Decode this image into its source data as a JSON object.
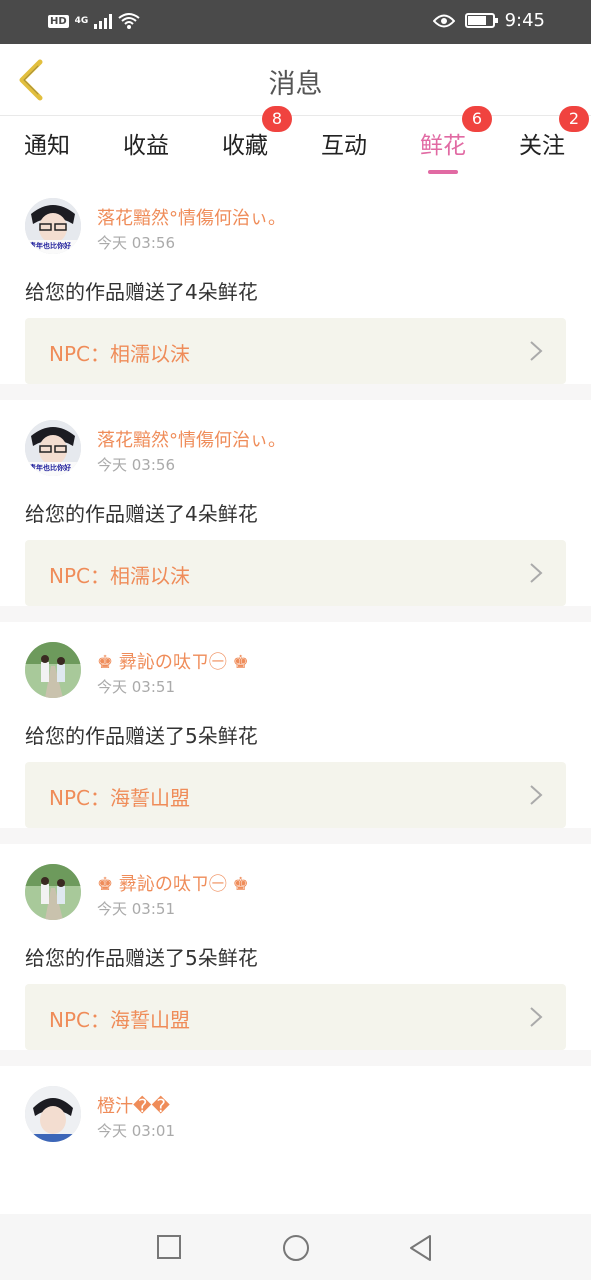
{
  "status_bar": {
    "hd": "HD",
    "network": "4G",
    "time": "9:45",
    "icons": [
      "hd-icon",
      "signal-icon",
      "wifi-icon",
      "eye-icon",
      "battery-icon"
    ]
  },
  "nav": {
    "title": "消息",
    "back_icon": "chevron-left-icon"
  },
  "tabs": [
    {
      "label": "通知"
    },
    {
      "label": "收益"
    },
    {
      "label": "收藏",
      "badge": "8"
    },
    {
      "label": "互动"
    },
    {
      "label": "鲜花",
      "badge": "6",
      "active": true
    },
    {
      "label": "关注",
      "badge": "2"
    }
  ],
  "colors": {
    "accent": "#e16aa3",
    "username": "#ef8c59",
    "badge": "#f0433f",
    "npc_bg": "#f4f4ec"
  },
  "messages": [
    {
      "username": "落花黯然°情傷何治ぃ。",
      "time": "今天 03:56",
      "text": "给您的作品赠送了4朵鲜花",
      "npc": "NPC：相濡以沫",
      "avatar_caption": "青年也比你好"
    },
    {
      "username": "落花黯然°情傷何治ぃ。",
      "time": "今天 03:56",
      "text": "给您的作品赠送了4朵鲜花",
      "npc": "NPC：相濡以沫",
      "avatar_caption": "青年也比你好"
    },
    {
      "username": "♚ 彛訫の呔ㄗ㊀ ♚",
      "time": "今天 03:51",
      "text": "给您的作品赠送了5朵鲜花",
      "npc": "NPC：海誓山盟"
    },
    {
      "username": "♚ 彛訫の呔ㄗ㊀ ♚",
      "time": "今天 03:51",
      "text": "给您的作品赠送了5朵鲜花",
      "npc": "NPC：海誓山盟"
    },
    {
      "username": "橙汁��",
      "time": "今天 03:01"
    }
  ],
  "bottom_nav": [
    "square-icon",
    "circle-icon",
    "triangle-back-icon"
  ]
}
